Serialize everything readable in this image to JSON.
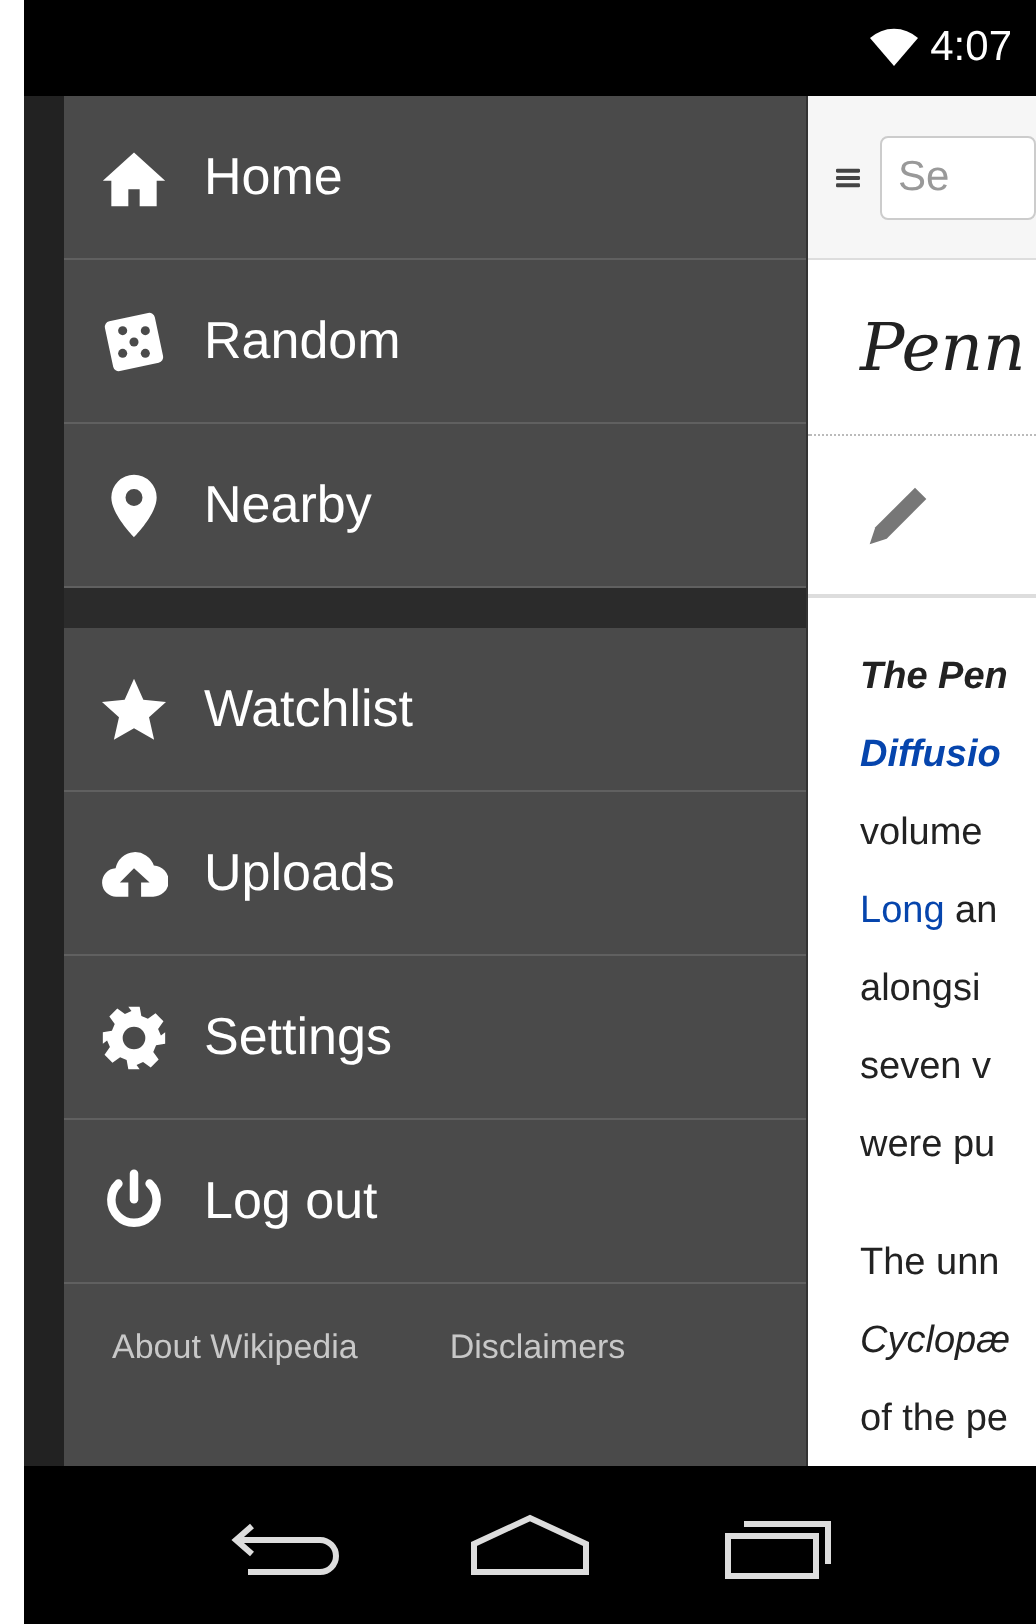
{
  "status_bar": {
    "time": "4:07"
  },
  "menu": {
    "groups": [
      [
        {
          "label": "Home"
        },
        {
          "label": "Random"
        },
        {
          "label": "Nearby"
        }
      ],
      [
        {
          "label": "Watchlist"
        },
        {
          "label": "Uploads"
        },
        {
          "label": "Settings"
        },
        {
          "label": "Log out"
        }
      ]
    ],
    "footer_links": [
      "About Wikipedia",
      "Disclaimers"
    ]
  },
  "article": {
    "search": {
      "placeholder": "Se"
    },
    "title": "Penn",
    "paragraphs": [
      [
        [
          {
            "text": "The Pen",
            "kind": "bold"
          }
        ],
        [
          {
            "text": "Diffusio",
            "kind": "bold-link"
          }
        ],
        [
          {
            "text": "volume",
            "kind": "plain"
          }
        ],
        [
          {
            "text": "Long",
            "kind": "link"
          },
          {
            "text": " an",
            "kind": "plain"
          }
        ],
        [
          {
            "text": "alongsi",
            "kind": "plain"
          }
        ],
        [
          {
            "text": "seven v",
            "kind": "plain"
          }
        ],
        [
          {
            "text": "were pu",
            "kind": "plain"
          }
        ]
      ],
      [
        [
          {
            "text": "The unn",
            "kind": "plain"
          }
        ],
        [
          {
            "text": "Cyclopæ",
            "kind": "italic"
          }
        ],
        [
          {
            "text": "of the pe",
            "kind": "plain"
          }
        ]
      ]
    ]
  }
}
